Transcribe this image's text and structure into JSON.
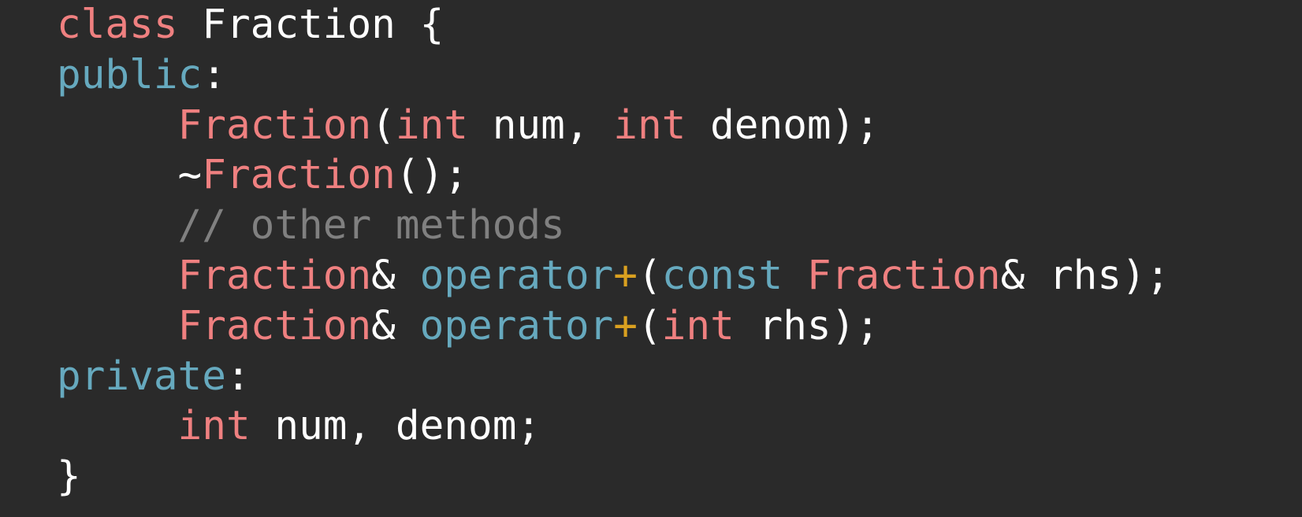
{
  "colors": {
    "background": "#2a2a2a",
    "keyword": "#ef8080",
    "access": "#66a9be",
    "plain": "#ffffff",
    "comment": "#808080",
    "operator": "#d9a020"
  },
  "lines": [
    [
      {
        "text": "class",
        "type": "keyword"
      },
      {
        "text": " Fraction {",
        "type": "plain"
      }
    ],
    [
      {
        "text": "public",
        "type": "access"
      },
      {
        "text": ":",
        "type": "plain"
      }
    ],
    [
      {
        "text": "     ",
        "type": "plain"
      },
      {
        "text": "Fraction",
        "type": "keyword"
      },
      {
        "text": "(",
        "type": "plain"
      },
      {
        "text": "int",
        "type": "keyword"
      },
      {
        "text": " num, ",
        "type": "plain"
      },
      {
        "text": "int",
        "type": "keyword"
      },
      {
        "text": " denom);",
        "type": "plain"
      }
    ],
    [
      {
        "text": "     ~",
        "type": "plain"
      },
      {
        "text": "Fraction",
        "type": "keyword"
      },
      {
        "text": "();",
        "type": "plain"
      }
    ],
    [
      {
        "text": "     // other methods",
        "type": "comment"
      }
    ],
    [
      {
        "text": "     ",
        "type": "plain"
      },
      {
        "text": "Fraction",
        "type": "keyword"
      },
      {
        "text": "& ",
        "type": "plain"
      },
      {
        "text": "operator",
        "type": "access"
      },
      {
        "text": "+",
        "type": "operator"
      },
      {
        "text": "(",
        "type": "plain"
      },
      {
        "text": "const",
        "type": "access"
      },
      {
        "text": " ",
        "type": "plain"
      },
      {
        "text": "Fraction",
        "type": "keyword"
      },
      {
        "text": "& rhs);",
        "type": "plain"
      }
    ],
    [
      {
        "text": "     ",
        "type": "plain"
      },
      {
        "text": "Fraction",
        "type": "keyword"
      },
      {
        "text": "& ",
        "type": "plain"
      },
      {
        "text": "operator",
        "type": "access"
      },
      {
        "text": "+",
        "type": "operator"
      },
      {
        "text": "(",
        "type": "plain"
      },
      {
        "text": "int",
        "type": "keyword"
      },
      {
        "text": " rhs);",
        "type": "plain"
      }
    ],
    [
      {
        "text": "private",
        "type": "access"
      },
      {
        "text": ":",
        "type": "plain"
      }
    ],
    [
      {
        "text": "     ",
        "type": "plain"
      },
      {
        "text": "int",
        "type": "keyword"
      },
      {
        "text": " num, denom;",
        "type": "plain"
      }
    ],
    [
      {
        "text": "}",
        "type": "plain"
      }
    ]
  ]
}
